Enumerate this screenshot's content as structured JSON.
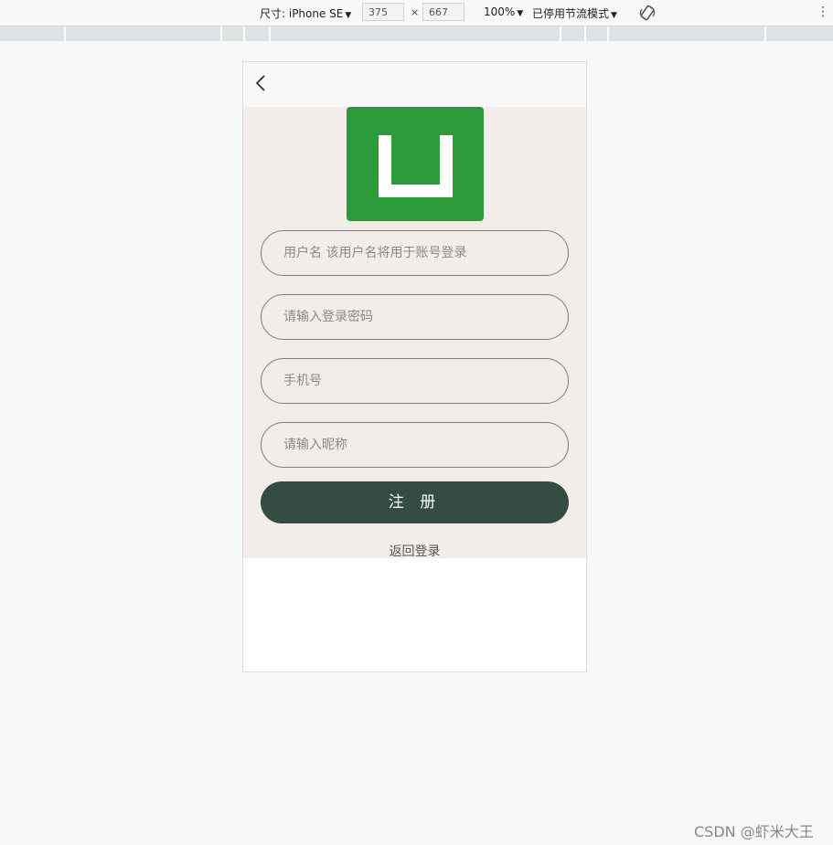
{
  "devtools": {
    "device_label": "尺寸: iPhone SE",
    "width_value": "375",
    "times": "×",
    "height_value": "667",
    "zoom": "100%",
    "throttle": "已停用节流模式"
  },
  "form": {
    "username_placeholder": "用户名 该用户名将用于账号登录",
    "password_placeholder": "请输入登录密码",
    "phone_placeholder": "手机号",
    "nickname_placeholder": "请输入昵称",
    "register_label": "注 册",
    "back_to_login": "返回登录"
  },
  "colors": {
    "logo_green": "#2a9a3a",
    "button_bg": "#344c44",
    "content_bg": "#f2ede8"
  },
  "watermark": "CSDN @虾米大王"
}
